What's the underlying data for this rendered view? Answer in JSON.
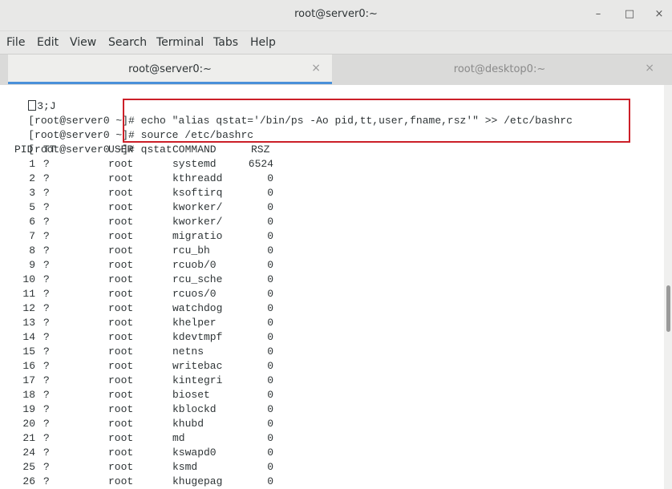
{
  "window": {
    "title": "root@server0:~",
    "minimize_glyph": "–",
    "maximize_glyph": "□",
    "close_glyph": "×"
  },
  "menu": [
    "File",
    "Edit",
    "View",
    "Search",
    "Terminal",
    "Tabs",
    "Help"
  ],
  "tabs": [
    {
      "label": "root@server0:~",
      "active": true,
      "close_glyph": "×"
    },
    {
      "label": "root@desktop0:~",
      "active": false,
      "close_glyph": "×"
    }
  ],
  "terminal": {
    "first_line_text": "3;J",
    "prompt": "[root@server0 ~]# ",
    "commands": [
      "echo \"alias qstat='/bin/ps -Ao pid,tt,user,fname,rsz'\" >> /etc/bashrc",
      "source /etc/bashrc",
      "qstat"
    ],
    "headers": {
      "pid": "PID",
      "tt": "TT",
      "user": "USER",
      "command": "COMMAND",
      "rsz": "RSZ"
    },
    "rows": [
      {
        "pid": "1",
        "tt": "?",
        "user": "root",
        "command": "systemd",
        "rsz": "6524"
      },
      {
        "pid": "2",
        "tt": "?",
        "user": "root",
        "command": "kthreadd",
        "rsz": "0"
      },
      {
        "pid": "3",
        "tt": "?",
        "user": "root",
        "command": "ksoftirq",
        "rsz": "0"
      },
      {
        "pid": "5",
        "tt": "?",
        "user": "root",
        "command": "kworker/",
        "rsz": "0"
      },
      {
        "pid": "6",
        "tt": "?",
        "user": "root",
        "command": "kworker/",
        "rsz": "0"
      },
      {
        "pid": "7",
        "tt": "?",
        "user": "root",
        "command": "migratio",
        "rsz": "0"
      },
      {
        "pid": "8",
        "tt": "?",
        "user": "root",
        "command": "rcu_bh",
        "rsz": "0"
      },
      {
        "pid": "9",
        "tt": "?",
        "user": "root",
        "command": "rcuob/0",
        "rsz": "0"
      },
      {
        "pid": "10",
        "tt": "?",
        "user": "root",
        "command": "rcu_sche",
        "rsz": "0"
      },
      {
        "pid": "11",
        "tt": "?",
        "user": "root",
        "command": "rcuos/0",
        "rsz": "0"
      },
      {
        "pid": "12",
        "tt": "?",
        "user": "root",
        "command": "watchdog",
        "rsz": "0"
      },
      {
        "pid": "13",
        "tt": "?",
        "user": "root",
        "command": "khelper",
        "rsz": "0"
      },
      {
        "pid": "14",
        "tt": "?",
        "user": "root",
        "command": "kdevtmpf",
        "rsz": "0"
      },
      {
        "pid": "15",
        "tt": "?",
        "user": "root",
        "command": "netns",
        "rsz": "0"
      },
      {
        "pid": "16",
        "tt": "?",
        "user": "root",
        "command": "writebac",
        "rsz": "0"
      },
      {
        "pid": "17",
        "tt": "?",
        "user": "root",
        "command": "kintegri",
        "rsz": "0"
      },
      {
        "pid": "18",
        "tt": "?",
        "user": "root",
        "command": "bioset",
        "rsz": "0"
      },
      {
        "pid": "19",
        "tt": "?",
        "user": "root",
        "command": "kblockd",
        "rsz": "0"
      },
      {
        "pid": "20",
        "tt": "?",
        "user": "root",
        "command": "khubd",
        "rsz": "0"
      },
      {
        "pid": "21",
        "tt": "?",
        "user": "root",
        "command": "md",
        "rsz": "0"
      },
      {
        "pid": "24",
        "tt": "?",
        "user": "root",
        "command": "kswapd0",
        "rsz": "0"
      },
      {
        "pid": "25",
        "tt": "?",
        "user": "root",
        "command": "ksmd",
        "rsz": "0"
      },
      {
        "pid": "26",
        "tt": "?",
        "user": "root",
        "command": "khugepag",
        "rsz": "0"
      }
    ]
  },
  "colors": {
    "highlight_box": "#cc1f28",
    "active_tab_underline": "#4a90d9",
    "text": "#2e3436"
  }
}
